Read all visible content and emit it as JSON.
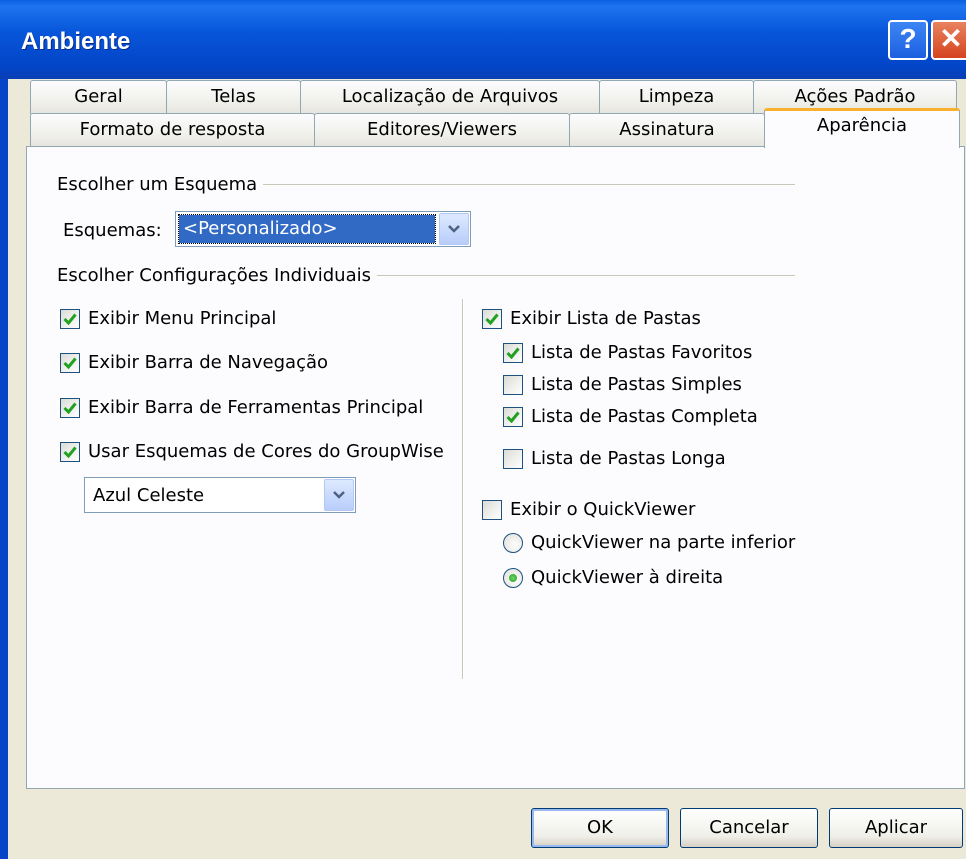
{
  "window": {
    "title": "Ambiente",
    "help_label": "?",
    "close_label": "✕"
  },
  "tabs": {
    "row_back": [
      "Geral",
      "Telas",
      "Localização de Arquivos",
      "Limpeza",
      "Ações Padrão"
    ],
    "row_front": [
      "Formato de resposta",
      "Editores/Viewers",
      "Assinatura",
      "Aparência"
    ],
    "active": "Aparência"
  },
  "scheme": {
    "group_label": "Escolher um Esquema",
    "field_label": "Esquemas:",
    "selected_value": "<Personalizado>"
  },
  "individual": {
    "group_label": "Escolher Configurações Individuais",
    "left": [
      {
        "label": "Exibir Menu Principal",
        "checked": true
      },
      {
        "label": "Exibir Barra de Navegação",
        "checked": true
      },
      {
        "label": "Exibir Barra de Ferramentas Principal",
        "checked": true
      },
      {
        "label": "Usar Esquemas de Cores do GroupWise",
        "checked": true
      }
    ],
    "color_scheme_value": "Azul Celeste",
    "folder_list": {
      "label": "Exibir Lista de Pastas",
      "checked": true
    },
    "folder_options": [
      {
        "label": "Lista de Pastas Favoritos",
        "checked": true
      },
      {
        "label": "Lista de Pastas Simples",
        "checked": false
      },
      {
        "label": "Lista de Pastas Completa",
        "checked": true
      },
      {
        "label": "Lista de Pastas Longa",
        "checked": false
      }
    ],
    "quickviewer": {
      "label": "Exibir o QuickViewer",
      "checked": false
    },
    "quickviewer_options": [
      {
        "label": "QuickViewer na parte inferior",
        "selected": false
      },
      {
        "label": "QuickViewer à direita",
        "selected": true
      }
    ]
  },
  "buttons": {
    "ok": "OK",
    "cancel": "Cancelar",
    "apply": "Aplicar"
  },
  "colors": {
    "titlebar": "#0A52D8",
    "check": "#21A121",
    "selection": "#316AC5",
    "active_tab_accent": "#F7B12E"
  }
}
